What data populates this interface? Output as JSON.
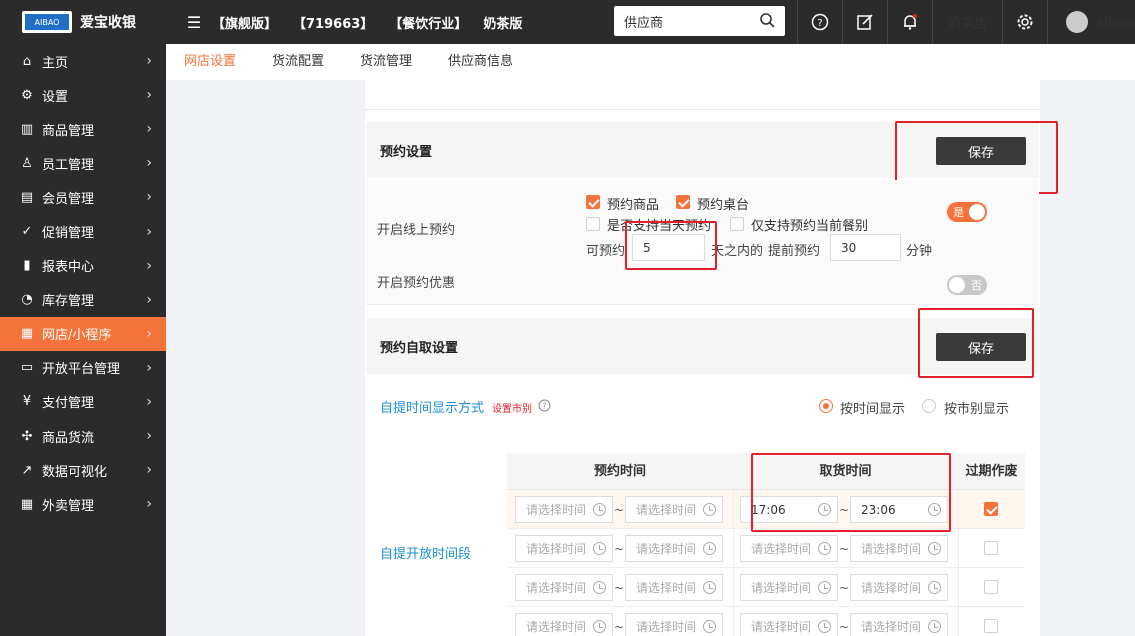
{
  "app": {
    "name": "爱宝收银",
    "logo_text": "AIBAO"
  },
  "topbar": {
    "edition_tags": [
      "【旗舰版】",
      "【719663】",
      "【餐饮行业】",
      "奶茶版"
    ],
    "search_value": "供应商",
    "store": "奶茶店",
    "user": "aibaon"
  },
  "sidebar": {
    "items": [
      {
        "label": "主页",
        "icon": "home-icon"
      },
      {
        "label": "设置",
        "icon": "gear-icon"
      },
      {
        "label": "商品管理",
        "icon": "barcode-icon"
      },
      {
        "label": "员工管理",
        "icon": "person-icon"
      },
      {
        "label": "会员管理",
        "icon": "member-card-icon"
      },
      {
        "label": "促销管理",
        "icon": "check-circle-icon"
      },
      {
        "label": "报表中心",
        "icon": "bar-chart-icon"
      },
      {
        "label": "库存管理",
        "icon": "pie-chart-icon"
      },
      {
        "label": "网店/小程序",
        "icon": "store-icon"
      },
      {
        "label": "开放平台管理",
        "icon": "monitor-icon"
      },
      {
        "label": "支付管理",
        "icon": "yuan-icon"
      },
      {
        "label": "商品货流",
        "icon": "flow-icon"
      },
      {
        "label": "数据可视化",
        "icon": "line-chart-icon"
      },
      {
        "label": "外卖管理",
        "icon": "store-icon"
      }
    ],
    "active_index": 8
  },
  "subtabs": [
    "网店设置",
    "货流配置",
    "货流管理",
    "供应商信息"
  ],
  "reservation": {
    "title": "预约设置",
    "save": "保存",
    "enable_online_label": "开启线上预约",
    "options": [
      {
        "label": "预约商品",
        "checked": true
      },
      {
        "label": "预约桌台",
        "checked": true
      },
      {
        "label": "是否支持当天预约",
        "checked": false
      },
      {
        "label": "仅支持预约当前餐别",
        "checked": false
      }
    ],
    "reservable_prefix": "可预约",
    "days_value": "5",
    "days_suffix": "天之内的",
    "advance_prefix": "提前预约",
    "minutes_value": "30",
    "minutes_suffix": "分钟",
    "toggle_on_text": "是",
    "discount_label": "开启预约优惠",
    "toggle_off_text": "否"
  },
  "pickup": {
    "title": "预约自取设置",
    "save": "保存",
    "display_mode_label": "自提时间显示方式",
    "set_period_link": "设置市别",
    "radio_time": "按时间显示",
    "radio_period": "按市别显示",
    "open_period_label": "自提开放时间段",
    "headers": [
      "预约时间",
      "取货时间",
      "过期作废"
    ],
    "placeholder": "请选择时间",
    "rows": [
      {
        "reserve_start": "",
        "reserve_end": "",
        "pickup_start": "17:06",
        "pickup_end": "23:06",
        "expire": true
      },
      {
        "reserve_start": "",
        "reserve_end": "",
        "pickup_start": "",
        "pickup_end": "",
        "expire": false
      },
      {
        "reserve_start": "",
        "reserve_end": "",
        "pickup_start": "",
        "pickup_end": "",
        "expire": false
      },
      {
        "reserve_start": "",
        "reserve_end": "",
        "pickup_start": "",
        "pickup_end": "",
        "expire": false
      }
    ]
  },
  "colors": {
    "accent": "#f4733a",
    "dark": "#2b2b2b",
    "highlight_box": "#e0202a",
    "link": "#1a8fd0"
  }
}
